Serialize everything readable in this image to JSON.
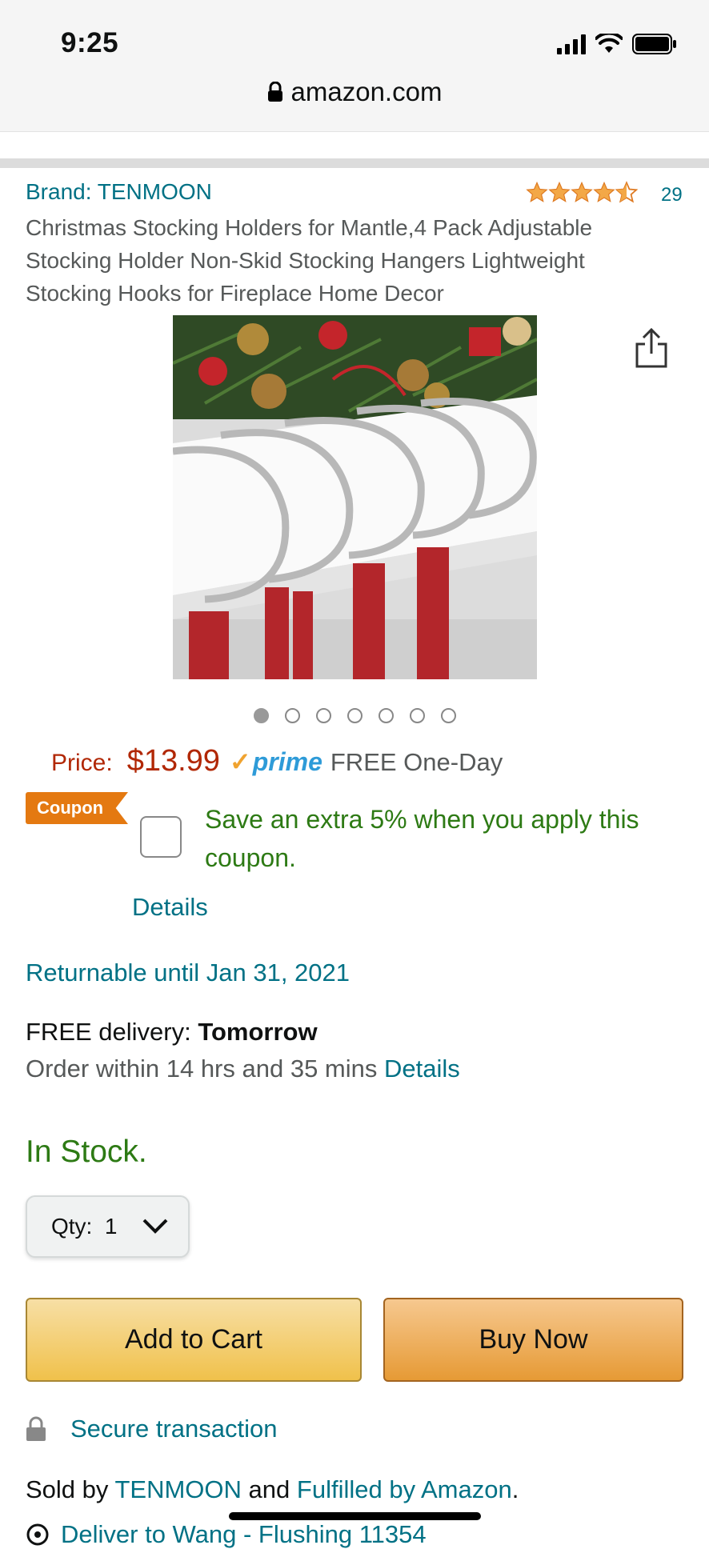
{
  "status_bar": {
    "time": "9:25"
  },
  "browser": {
    "url": "amazon.com"
  },
  "product": {
    "brand": "Brand: TENMOON",
    "rating_count": "29",
    "rating_stars": 4.5,
    "title": "Christmas Stocking Holders for Mantle,4 Pack Adjustable Stocking Holder Non-Skid Stocking Hangers Lightweight Stocking Hooks for Fireplace Home Decor",
    "image_dots": 7,
    "active_dot": 0
  },
  "price": {
    "label": "Price:",
    "value": "$13.99",
    "prime_check": "✓",
    "prime_word": "prime",
    "shipping": "FREE One-Day"
  },
  "coupon": {
    "badge": "Coupon",
    "text": "Save an extra 5% when you apply this coupon.",
    "details": "Details"
  },
  "returnable": "Returnable until Jan 31, 2021",
  "delivery": {
    "prefix": "FREE delivery:",
    "day": "Tomorrow",
    "order_within": "Order within 14 hrs and 35 mins",
    "details": "Details"
  },
  "stock": "In Stock.",
  "quantity": {
    "label": "Qty:",
    "value": "1"
  },
  "buttons": {
    "add_to_cart": "Add to Cart",
    "buy_now": "Buy Now"
  },
  "secure": "Secure transaction",
  "sold_by": {
    "prefix": "Sold by",
    "seller": "TENMOON",
    "middle": "and",
    "fulfilled": "Fulfilled by Amazon",
    "suffix": "."
  },
  "deliver_to": "Deliver to Wang - Flushing 11354",
  "colors": {
    "link": "#007185",
    "price": "#b12704",
    "in_stock": "#2d7a14",
    "coupon_badge": "#e47911",
    "add_to_cart": "#f0c14b",
    "buy_now": "#e69a35"
  }
}
